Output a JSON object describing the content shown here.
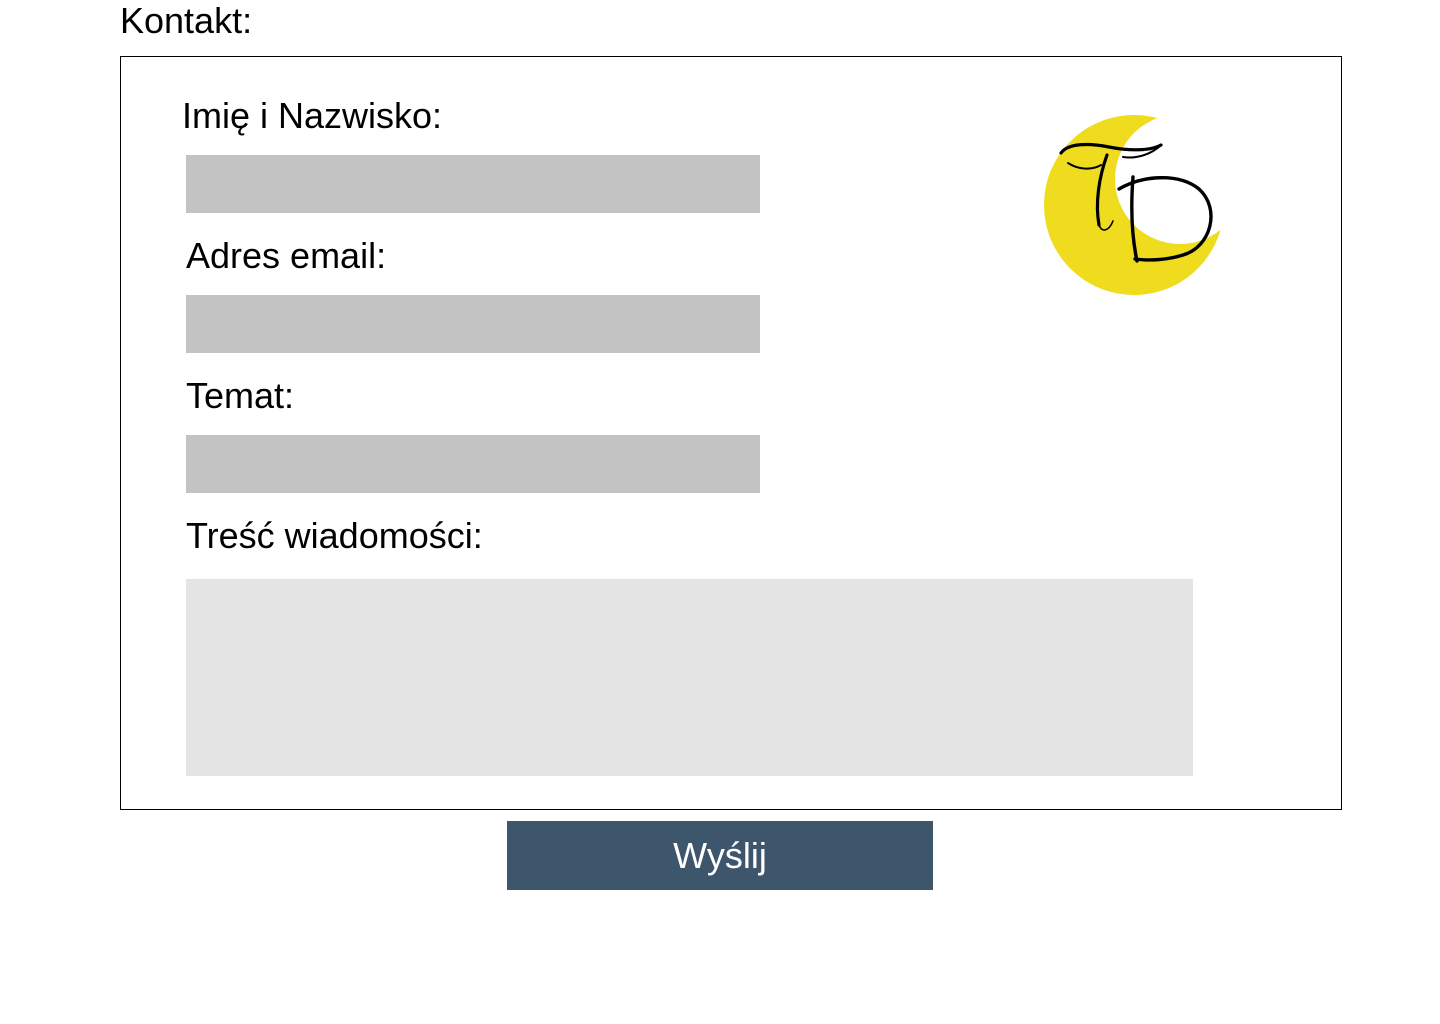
{
  "section": {
    "title": "Kontakt:"
  },
  "form": {
    "name_label": "Imię i Nazwisko:",
    "name_value": "",
    "email_label": "Adres email:",
    "email_value": "",
    "subject_label": "Temat:",
    "subject_value": "",
    "message_label": "Treść wiadomości:",
    "message_value": ""
  },
  "logo": {
    "text": "TD",
    "icon": "td-moon-logo-icon"
  },
  "submit": {
    "label": "Wyślij"
  },
  "colors": {
    "input_bg": "#c4c4c4",
    "textarea_bg": "#e4e4e4",
    "button_bg": "#3e566b",
    "button_text": "#ffffff",
    "logo_yellow": "#efdc1f"
  }
}
